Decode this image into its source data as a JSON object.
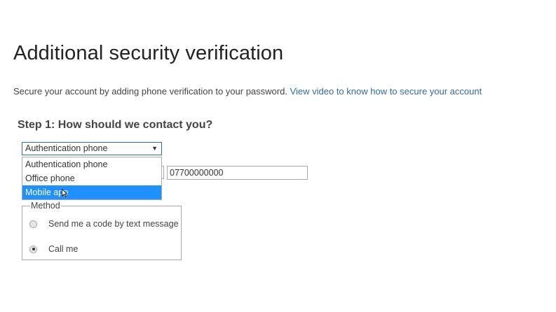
{
  "page": {
    "title": "Additional security verification",
    "subtitle_text": "Secure your account by adding phone verification to your password.",
    "subtitle_link": "View video to know how to secure your account"
  },
  "step1": {
    "heading": "Step 1: How should we contact you?",
    "contact_select": {
      "value": "Authentication phone",
      "arrow_icon": "triangle-down-icon",
      "options": [
        {
          "label": "Authentication phone",
          "highlighted": false
        },
        {
          "label": "Office phone",
          "highlighted": false
        },
        {
          "label": "Mobile app",
          "highlighted": true
        }
      ]
    },
    "phone_number": "07700000000",
    "method": {
      "legend": "Method",
      "options": [
        {
          "label": "Send me a code by text message",
          "checked": false
        },
        {
          "label": "Call me",
          "checked": true
        }
      ]
    }
  },
  "colors": {
    "link": "#2e6da4",
    "highlight": "#1e90ff",
    "focus_border": "#2b6cc4"
  }
}
